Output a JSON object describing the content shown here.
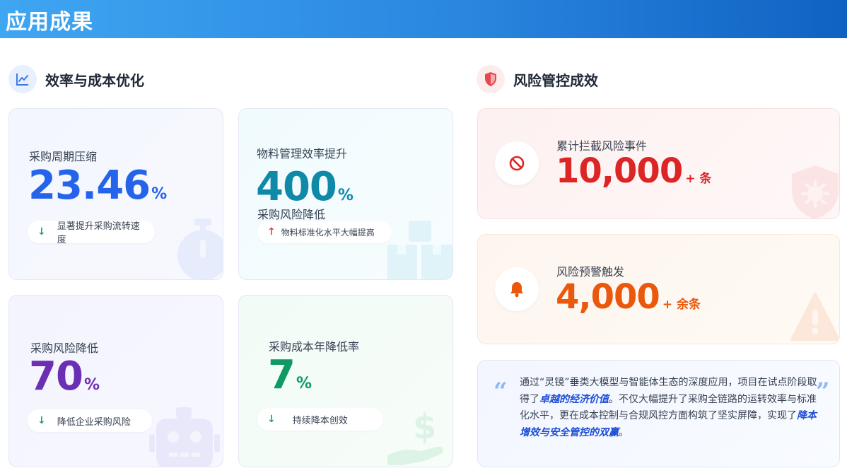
{
  "header": {
    "title": "应用成果"
  },
  "efficiency_section": {
    "title": "效率与成本优化",
    "icon": "trend-chart-icon",
    "cards": [
      {
        "label": "采购周期压缩",
        "value": "23.46",
        "unit": "%",
        "value_color": "#2563eb",
        "note": "显著提升采购流转速度",
        "note_direction": "down",
        "bg_icon": "stopwatch-icon"
      },
      {
        "label": "物料管理效率提升",
        "value": "400",
        "unit": "%",
        "value_color": "#0e8aa8",
        "sub_label": "采购风险降低",
        "note": "物料标准化水平大幅提高",
        "note_direction": "up",
        "bg_icon": "boxes-icon"
      },
      {
        "label": "采购风险降低",
        "value": "70",
        "unit": "%",
        "value_color": "#6b2fb3",
        "note": "降低企业采购风险",
        "note_direction": "down",
        "bg_icon": "robot-icon"
      },
      {
        "label": "采购成本年降低率",
        "value": "7",
        "unit": "%",
        "value_color": "#0f9a63",
        "note": "持续降本创效",
        "note_direction": "down",
        "bg_icon": "dollar-hand-icon"
      }
    ]
  },
  "risk_section": {
    "title": "风险管控成效",
    "icon": "shield-icon",
    "cards": [
      {
        "label": "累计拦截风险事件",
        "value": "10,000",
        "unit": "+ 条",
        "value_color": "#dc2626",
        "icon": "ban-icon",
        "bg_icon": "shield-virus-icon"
      },
      {
        "label": "风险预警触发",
        "value": "4,000",
        "unit": "+ 余条",
        "value_color": "#ea580c",
        "icon": "bell-icon",
        "bg_icon": "warning-icon"
      }
    ],
    "quote": {
      "part1": "通过“灵镜”垂类大模型与智能体生态的深度应用，项目在试点阶段取得了",
      "em1": "卓越的经济价值",
      "part2": "。不仅大幅提升了采购全链路的运转效率与标准化水平，更在成本控制与合规风控方面构筑了坚实屏障，实现了",
      "em2": "降本增效与安全管控的双赢",
      "part3": "。"
    }
  },
  "colors": {
    "header_start": "#3fa6f2",
    "header_end": "#1062c2",
    "arrow_down": "#22a65a",
    "arrow_up": "#e0453a"
  }
}
